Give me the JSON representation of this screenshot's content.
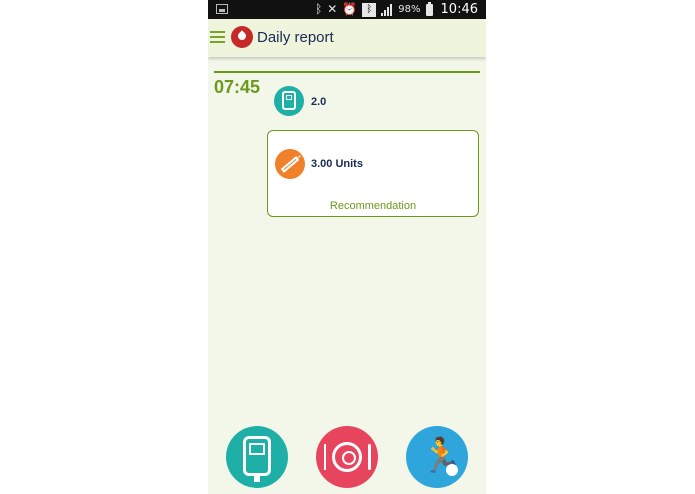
{
  "status_bar": {
    "battery_percent": "98%",
    "time": "10:46",
    "icons": [
      "image-icon",
      "bluetooth-icon",
      "mute-icon",
      "alarm-icon",
      "bluetooth-box-icon",
      "signal-icon",
      "battery-icon"
    ]
  },
  "app_bar": {
    "title": "Daily report",
    "menu_icon": "hamburger-menu-icon",
    "logo_icon": "blood-drop-icon"
  },
  "timeline": {
    "time": "07:45",
    "entries": [
      {
        "icon": "glucose-meter-icon",
        "value": "2.0"
      },
      {
        "icon": "syringe-icon",
        "value": "3.00 Units",
        "link": "Recommendation"
      }
    ]
  },
  "bottom_actions": [
    {
      "icon": "glucose-meter-icon",
      "color": "#1eafa6"
    },
    {
      "icon": "meal-plate-icon",
      "color": "#e7455e"
    },
    {
      "icon": "activity-runner-icon",
      "color": "#2ea6dc"
    }
  ],
  "colors": {
    "accent_green": "#6b9a1a",
    "background": "#f3f7e9",
    "text_dark": "#1b2a55",
    "insulin_orange": "#f0802a"
  }
}
